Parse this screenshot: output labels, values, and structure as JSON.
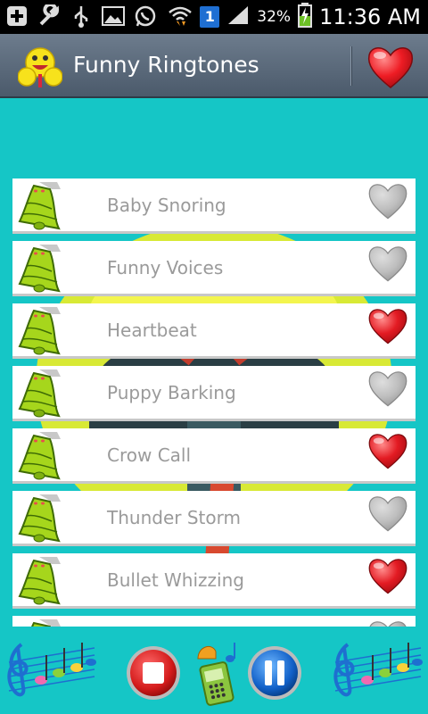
{
  "status": {
    "battery": "32%",
    "time": "11:36 AM",
    "notification": "1"
  },
  "header": {
    "title": "Funny Ringtones"
  },
  "ringtones": [
    {
      "label": "Baby Snoring",
      "favorite": false
    },
    {
      "label": "Funny Voices",
      "favorite": false
    },
    {
      "label": "Heartbeat",
      "favorite": true
    },
    {
      "label": "Puppy Barking",
      "favorite": false
    },
    {
      "label": "Crow Call",
      "favorite": true
    },
    {
      "label": "Thunder Storm",
      "favorite": false
    },
    {
      "label": "Bullet Whizzing",
      "favorite": true
    },
    {
      "label": "",
      "favorite": false
    }
  ],
  "colors": {
    "background": "#15c6c6",
    "favorite_on": "#e31b23",
    "favorite_off": "#bdbdbd",
    "label": "#9a9a9a"
  }
}
